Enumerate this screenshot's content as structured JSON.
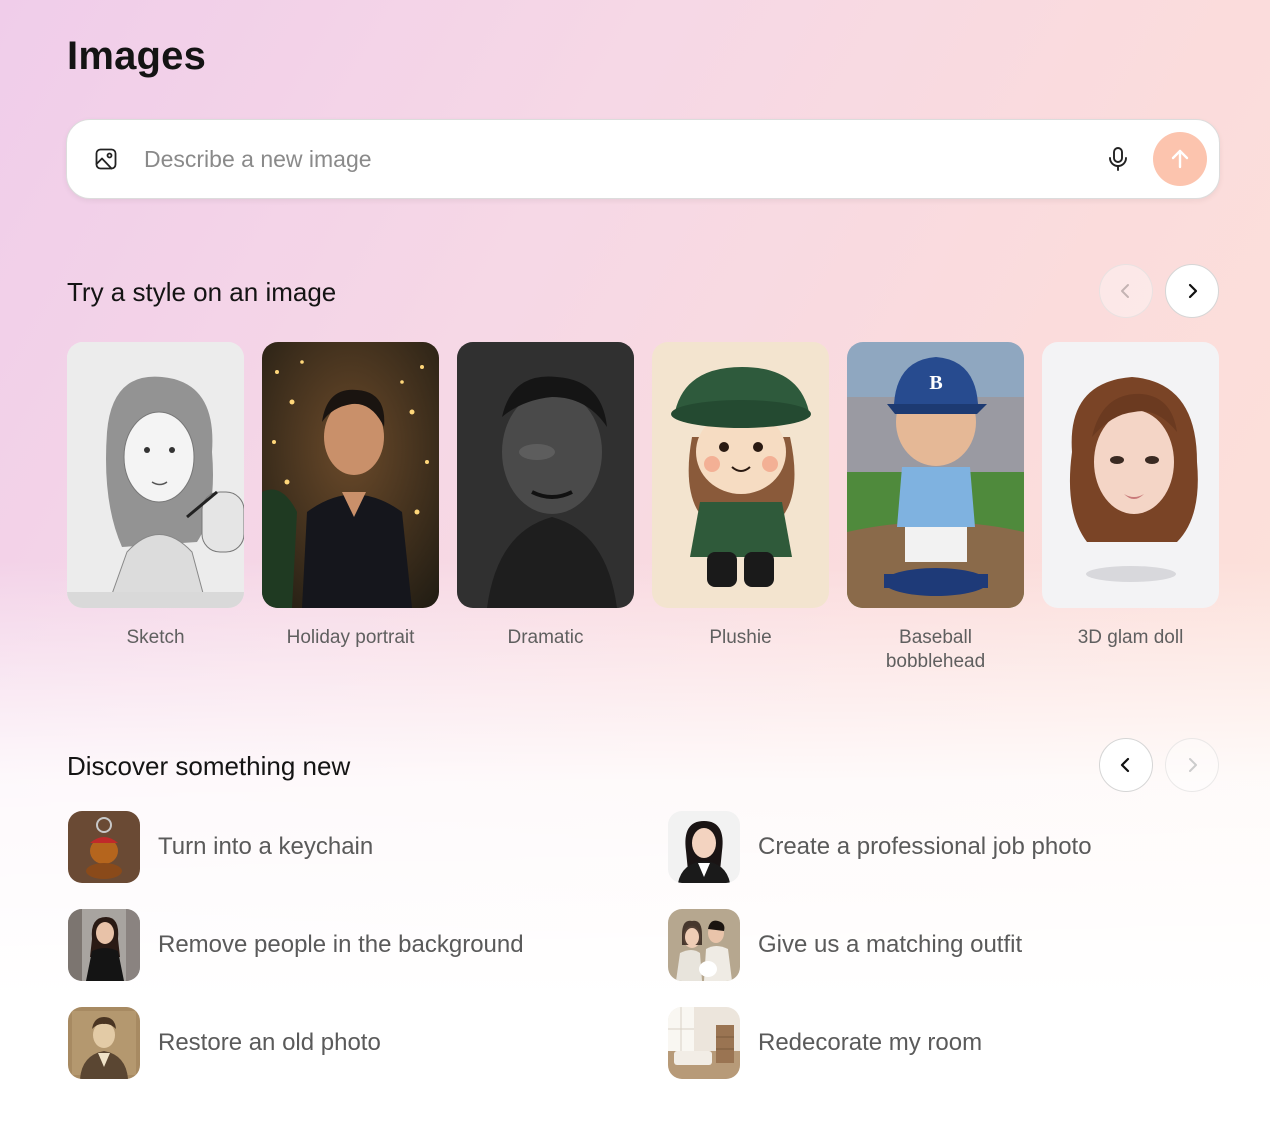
{
  "title": "Images",
  "search": {
    "placeholder": "Describe a new image",
    "value": "",
    "left_icon": "image-icon",
    "mic_icon": "microphone-icon",
    "send_icon": "arrow-up-icon",
    "send_color": "#fcc4ae"
  },
  "styles_section": {
    "title": "Try a style on an image",
    "prev_enabled": false,
    "next_enabled": true,
    "items": [
      {
        "label": "Sketch"
      },
      {
        "label": "Holiday portrait"
      },
      {
        "label": "Dramatic"
      },
      {
        "label": "Plushie"
      },
      {
        "label": "Baseball bobblehead"
      },
      {
        "label": "3D glam doll"
      }
    ]
  },
  "discover_section": {
    "title": "Discover something new",
    "prev_enabled": true,
    "next_enabled": false,
    "items": [
      {
        "label": "Turn into a keychain"
      },
      {
        "label": "Create a professional job photo"
      },
      {
        "label": "Remove people in the background"
      },
      {
        "label": "Give us a matching outfit"
      },
      {
        "label": "Restore an old photo"
      },
      {
        "label": "Redecorate my room"
      }
    ]
  }
}
